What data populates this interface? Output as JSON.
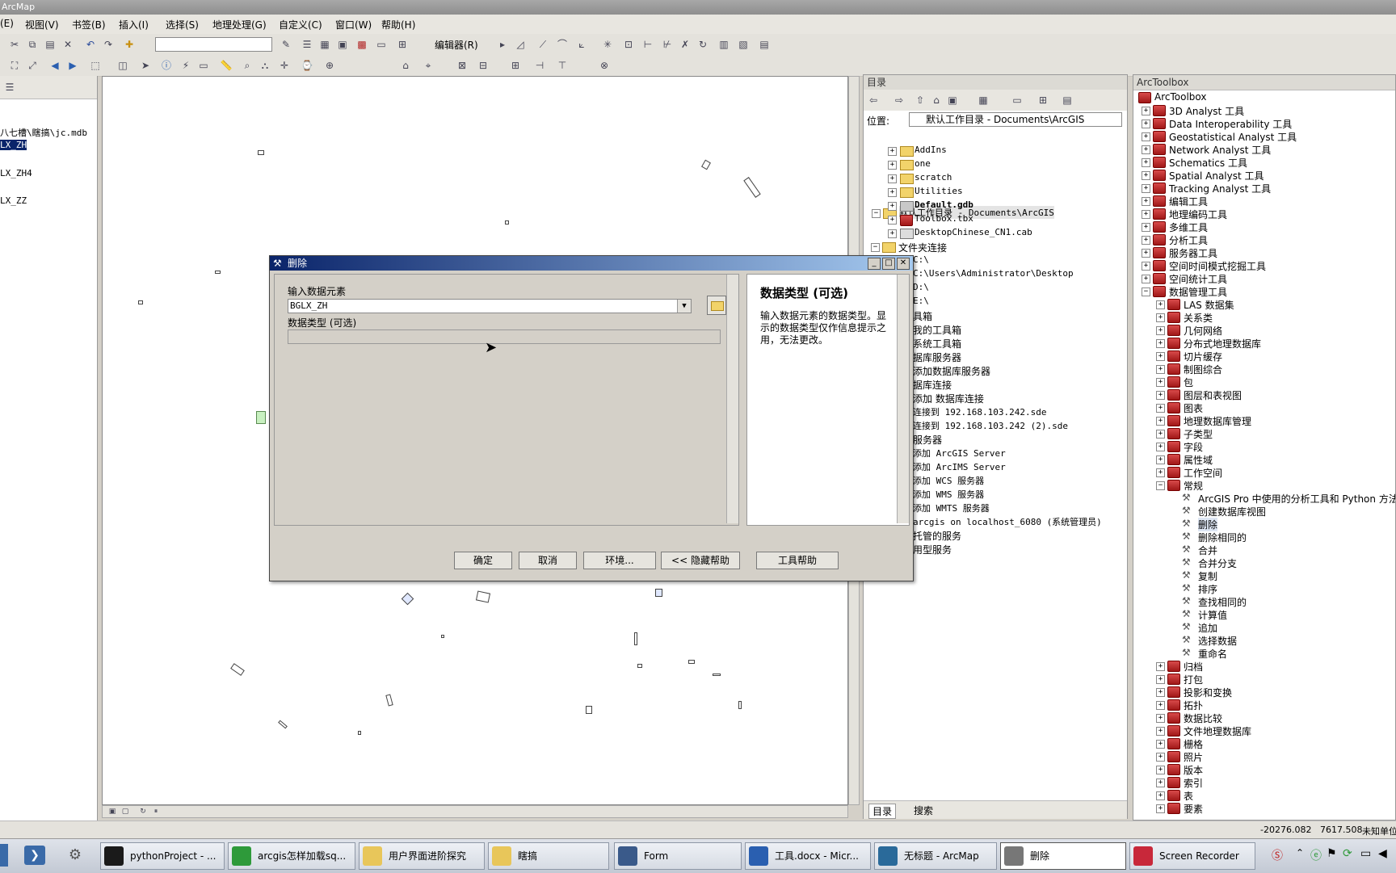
{
  "window_title": "ArcMap",
  "menu": [
    {
      "label": "(E)"
    },
    {
      "label": "视图(V)"
    },
    {
      "label": "书签(B)"
    },
    {
      "label": "插入(I)"
    },
    {
      "label": "选择(S)"
    },
    {
      "label": "地理处理(G)"
    },
    {
      "label": "自定义(C)"
    },
    {
      "label": "窗口(W)"
    },
    {
      "label": "帮助(H)"
    }
  ],
  "toolbar": {
    "editor_label": "编辑器(R)"
  },
  "toc": {
    "items": [
      "八七槽\\瞎搞\\jc.mdb",
      "LX_ZH",
      "LX_ZH4",
      "LX_ZZ"
    ]
  },
  "catalog": {
    "title": "目录",
    "location_label": "位置:",
    "location_value": "默认工作目录 - Documents\\ArcGIS",
    "items": [
      "默认工作目录 - Documents\\ArcGIS",
      "AddIns",
      "one",
      "scratch",
      "Utilities",
      "Default.gdb",
      "Toolbox.tbx",
      "DesktopChinese_CN1.cab",
      "文件夹连接",
      "C:\\",
      "C:\\Users\\Administrator\\Desktop",
      "D:\\",
      "E:\\",
      "具箱",
      "我的工具箱",
      "系统工具箱",
      "据库服务器",
      "添加数据库服务器",
      "据库连接",
      "添加 数据库连接",
      "连接到 192.168.103.242.sde",
      "连接到 192.168.103.242 (2).sde",
      "服务器",
      "添加 ArcGIS Server",
      "添加 ArcIMS Server",
      "添加 WCS 服务器",
      "添加 WMS 服务器",
      "添加 WMTS 服务器",
      "arcgis on localhost_6080 (系统管理员)",
      "托管的服务",
      "用型服务"
    ],
    "tab_catalog": "目录",
    "tab_search": "搜索"
  },
  "toolbox": {
    "title": "ArcToolbox",
    "items": [
      "ArcToolbox",
      "3D Analyst 工具",
      "Data Interoperability 工具",
      "Geostatistical Analyst 工具",
      "Network Analyst 工具",
      "Schematics 工具",
      "Spatial Analyst 工具",
      "Tracking Analyst 工具",
      "编辑工具",
      "地理编码工具",
      "多维工具",
      "分析工具",
      "服务器工具",
      "空间时间模式挖掘工具",
      "空间统计工具",
      "数据管理工具",
      "LAS 数据集",
      "关系类",
      "几何网络",
      "分布式地理数据库",
      "切片缓存",
      "制图综合",
      "包",
      "图层和表视图",
      "图表",
      "地理数据库管理",
      "子类型",
      "字段",
      "属性域",
      "工作空间",
      "常规",
      "ArcGIS Pro 中使用的分析工具和 Python 方法",
      "创建数据库视图",
      "删除",
      "删除相同的",
      "合并",
      "合并分支",
      "复制",
      "排序",
      "查找相同的",
      "计算值",
      "追加",
      "选择数据",
      "重命名",
      "归档",
      "打包",
      "投影和变换",
      "拓扑",
      "数据比较",
      "文件地理数据库",
      "栅格",
      "照片",
      "版本",
      "索引",
      "表",
      "要素"
    ]
  },
  "dialog": {
    "title": "删除",
    "input_label": "输入数据元素",
    "input_value": "BGLX_ZH",
    "type_label": "数据类型 (可选)",
    "type_value": "",
    "help_title": "数据类型 (可选)",
    "help_text": "输入数据元素的数据类型。显示的数据类型仅作信息提示之用，无法更改。",
    "buttons": {
      "ok": "确定",
      "cancel": "取消",
      "env": "环境...",
      "hide_help": "<< 隐藏帮助",
      "tool_help": "工具帮助"
    }
  },
  "status": {
    "x": "-20276.082",
    "y": "7617.508",
    "unit": "未知单位"
  },
  "taskbar": [
    {
      "label": "pythonProject - ...",
      "color": "#1a1a1a"
    },
    {
      "label": "arcgis怎样加载sq...",
      "color": "#2e9a3a"
    },
    {
      "label": "用户界面进阶探究",
      "color": "#e8c65a"
    },
    {
      "label": "瞎搞",
      "color": "#e8c65a"
    },
    {
      "label": "Form",
      "color": "#3a5a8a"
    },
    {
      "label": "工具.docx - Micr...",
      "color": "#2a5fb0"
    },
    {
      "label": "无标题 - ArcMap",
      "color": "#2a6a9a"
    },
    {
      "label": "删除",
      "color": "#777777"
    },
    {
      "label": "Screen Recorder",
      "color": "#c8283a"
    }
  ]
}
